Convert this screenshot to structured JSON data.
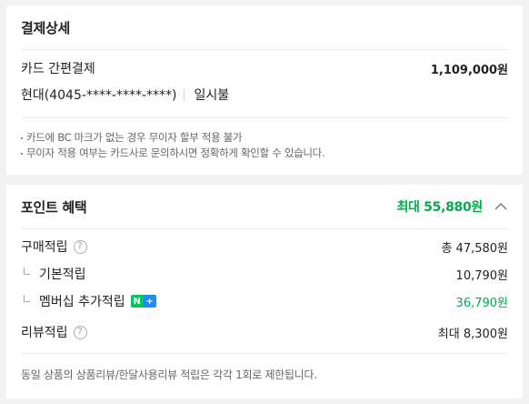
{
  "payment": {
    "title": "결제상세",
    "method_label": "카드 간편결제",
    "method_amount": "1,109,000원",
    "card_info": "현대(4045-****-****-****)",
    "installment": "일시불",
    "notes": [
      "카드에 BC 마크가 없는 경우 무이자 할부 적용 불가",
      "무이자 적용 여부는 카드사로 문의하시면 정확하게 확인할 수 있습니다."
    ]
  },
  "points": {
    "title": "포인트 혜택",
    "max_label": "최대 55,880원",
    "rows": [
      {
        "label": "구매적립",
        "amount": "총 47,580원"
      },
      {
        "label": "기본적립",
        "amount": "10,790원"
      },
      {
        "label": "멤버십 추가적립",
        "amount": "36,790원"
      },
      {
        "label": "리뷰적립",
        "amount": "최대 8,300원"
      }
    ],
    "help_glyph": "?",
    "badge": {
      "n": "N",
      "plus": "+"
    },
    "footnote": "동일 상품의 상품리뷰/한달사용리뷰 적립은 각각 1회로 제한됩니다."
  },
  "colors": {
    "accent_green": "#03a94d",
    "naver_green": "#03c75a",
    "blue": "#1a8cff"
  },
  "icons": {
    "collapse": "chevron-up-icon",
    "help": "question-circle-icon",
    "sub": "sub-item-corner-icon",
    "membership": "naver-plus-badge"
  }
}
